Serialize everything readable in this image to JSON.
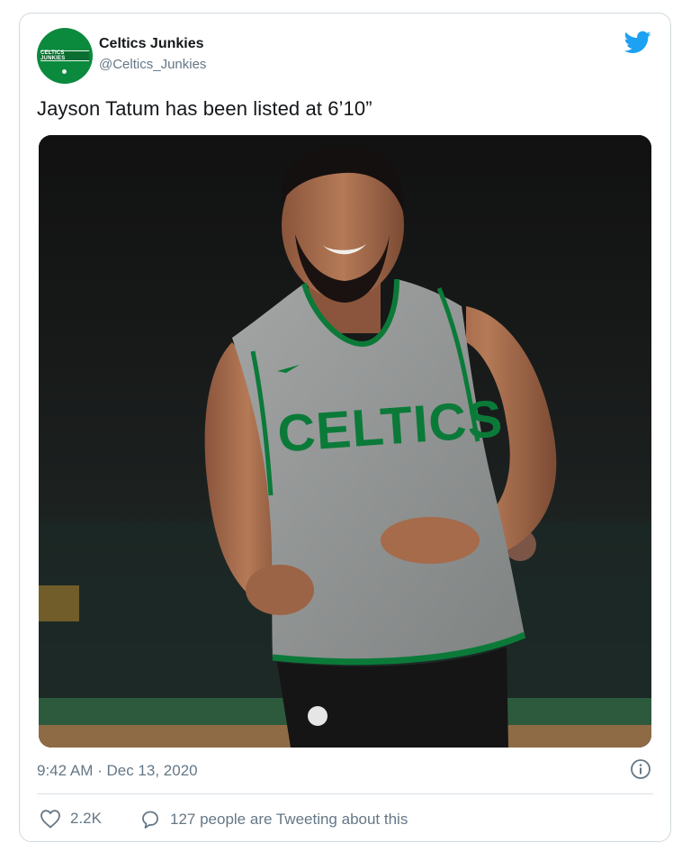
{
  "tweet": {
    "display_name": "Celtics Junkies",
    "handle": "@Celtics_Junkies",
    "text": "Jayson Tatum has been listed at 6’10”",
    "timestamp": "9:42 AM · Dec 13, 2020",
    "avatar_text": "CELTICS JUNKIES",
    "photo": {
      "jersey_text": "CELTICS"
    },
    "actions": {
      "likes": "2.2K",
      "conversation": "127 people are Tweeting about this"
    }
  },
  "icons": {
    "brand": "twitter-bird-icon",
    "info": "info-icon",
    "like": "heart-icon",
    "reply": "speech-bubble-icon"
  },
  "colors": {
    "twitter_blue": "#1da1f2",
    "celtics_green": "#0b8a3e",
    "muted_text": "#657786",
    "border": "#cfd9de"
  }
}
